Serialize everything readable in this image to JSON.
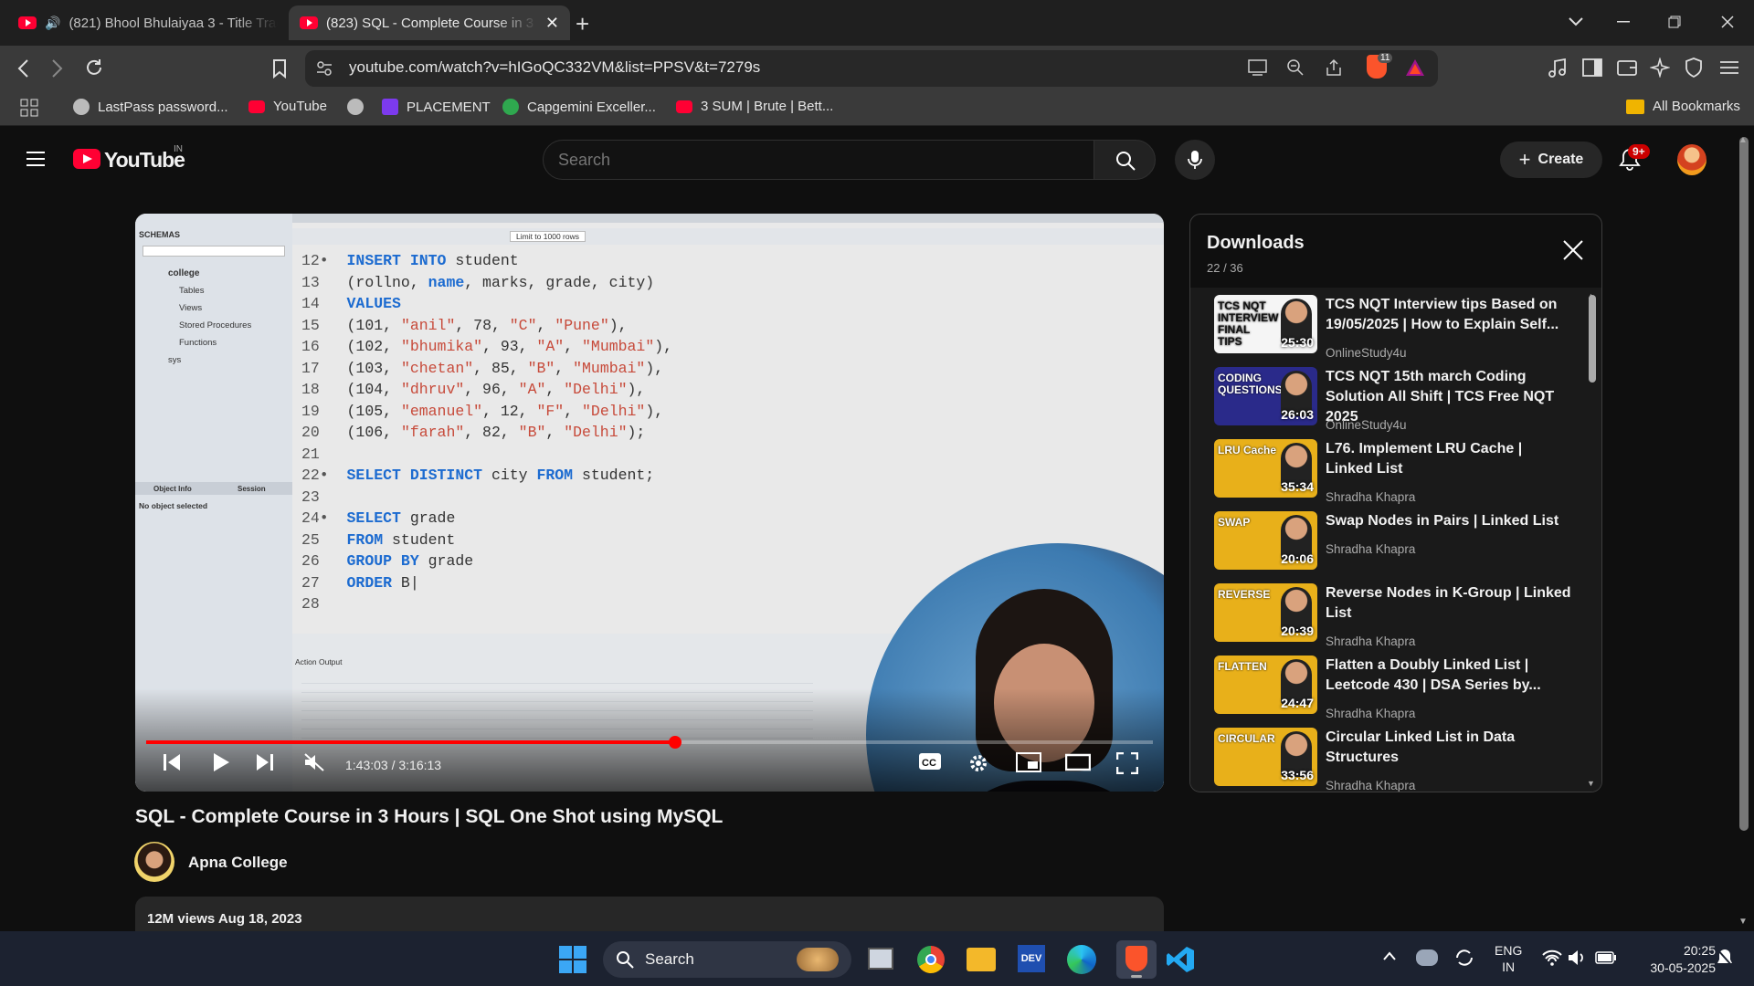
{
  "browser": {
    "tabs": [
      {
        "title": "(821) Bhool Bhulaiyaa 3 - Title Track"
      },
      {
        "title": "(823) SQL - Complete Course in 3 Hours"
      }
    ],
    "url": "youtube.com/watch?v=hIGoQC332VM&list=PPSV&t=7279s",
    "bookmarks": [
      {
        "label": "LastPass password..."
      },
      {
        "label": "YouTube"
      },
      {
        "label": "PLACEMENT"
      },
      {
        "label": "Capgemini Exceller..."
      },
      {
        "label": "3 SUM | Brute | Bett..."
      }
    ],
    "all_bookmarks": "All Bookmarks",
    "brave_badge": "11"
  },
  "youtube": {
    "logo": "YouTube",
    "region": "IN",
    "search_placeholder": "Search",
    "create": "Create",
    "notif_badge": "9+"
  },
  "video": {
    "title": "SQL - Complete Course in 3 Hours | SQL One Shot using MySQL",
    "channel": "Apna College",
    "views": "12M views",
    "date": "Aug 18, 2023",
    "time": "1:43:03 / 3:16:13",
    "progress": 0.525,
    "schema_label": "SCHEMAS",
    "db": "college",
    "tree": [
      "Tables",
      "Views",
      "Stored Procedures",
      "Functions",
      "sys"
    ],
    "object_info": "Object Info",
    "session": "Session",
    "no_object": "No object selected",
    "limit": "Limit to 1000 rows",
    "action_output": "Action Output"
  },
  "playlist": {
    "title": "Downloads",
    "count": "22 / 36",
    "items": [
      {
        "title": "TCS NQT Interview tips Based on 19/05/2025 | How to Explain Self...",
        "channel": "OnlineStudy4u",
        "duration": "25:30",
        "thumb_text": "TCS NQT INTERVIEW FINAL TIPS",
        "color": "#f5f5f5"
      },
      {
        "title": "TCS NQT 15th march Coding Solution All Shift | TCS Free NQT 2025",
        "channel": "OnlineStudy4u",
        "duration": "26:03",
        "thumb_text": "CODING QUESTIONS",
        "color": "#2a2a8a"
      },
      {
        "title": "L76. Implement LRU Cache | Linked List",
        "channel": "Shradha Khapra",
        "duration": "35:34",
        "thumb_text": "LRU Cache",
        "color": "#e8b01a"
      },
      {
        "title": "Swap Nodes in Pairs | Linked List",
        "channel": "Shradha Khapra",
        "duration": "20:06",
        "thumb_text": "SWAP",
        "color": "#e8b01a"
      },
      {
        "title": "Reverse Nodes in K-Group | Linked List",
        "channel": "Shradha Khapra",
        "duration": "20:39",
        "thumb_text": "REVERSE",
        "color": "#e8b01a"
      },
      {
        "title": "Flatten a Doubly Linked List | Leetcode 430 | DSA Series by...",
        "channel": "Shradha Khapra",
        "duration": "24:47",
        "thumb_text": "FLATTEN",
        "color": "#e8b01a"
      },
      {
        "title": "Circular Linked List in Data Structures",
        "channel": "Shradha Khapra",
        "duration": "33:56",
        "thumb_text": "CIRCULAR",
        "color": "#e8b01a"
      }
    ]
  },
  "taskbar": {
    "search": "Search",
    "lang1": "ENG",
    "lang2": "IN",
    "time": "20:25",
    "date": "30-05-2025"
  }
}
